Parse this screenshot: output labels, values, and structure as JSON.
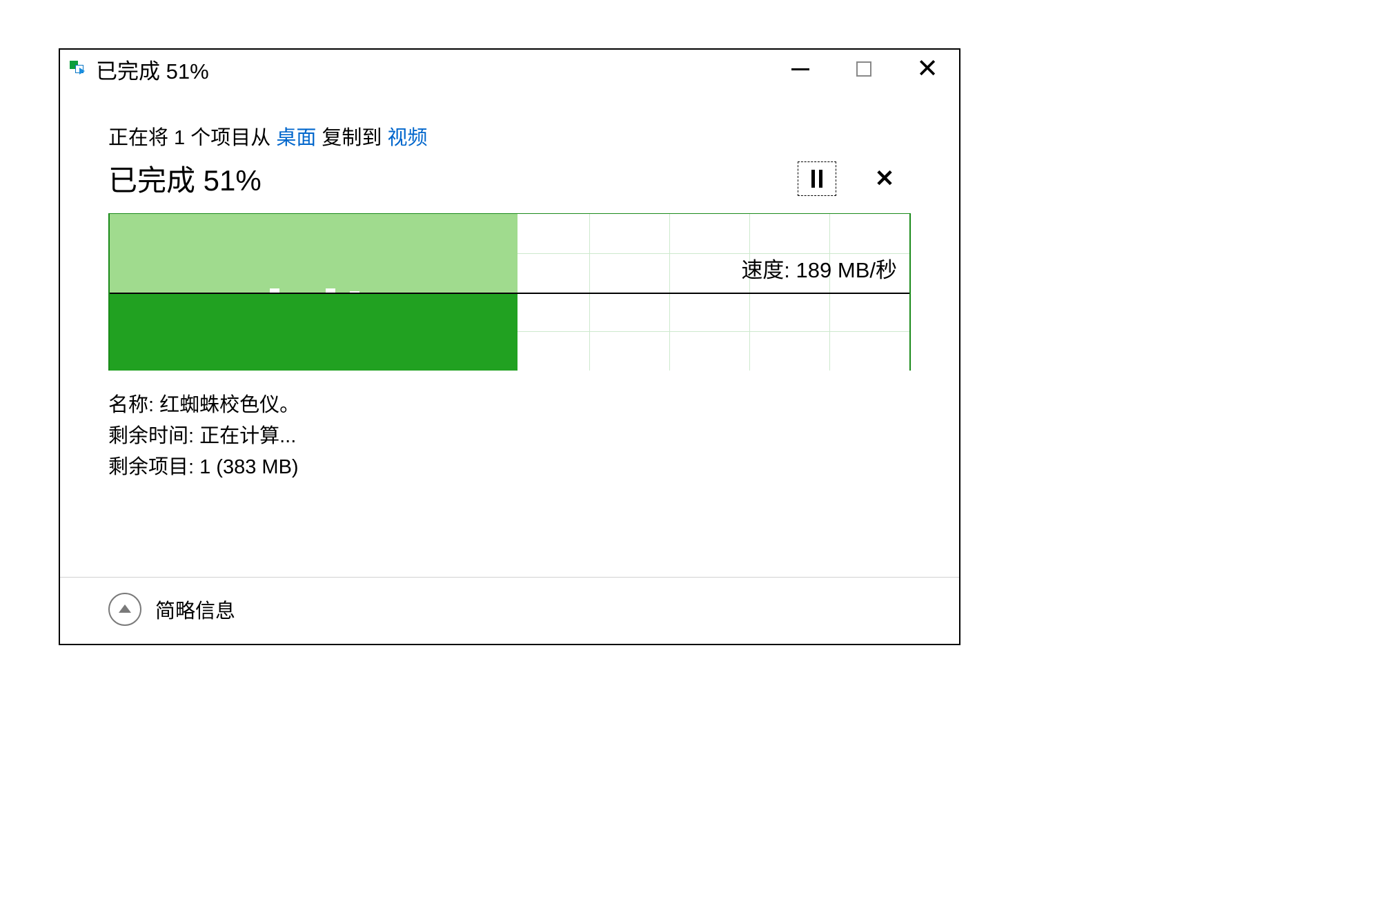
{
  "titlebar": {
    "title": "已完成 51%"
  },
  "copy_line": {
    "prefix": "正在将 1 个项目从 ",
    "source": "桌面",
    "middle": " 复制到 ",
    "destination": "视频"
  },
  "progress": {
    "percent_text": "已完成 51%",
    "fill_percent": 51,
    "speed_label_prefix": "速度: ",
    "speed_value": "189 MB/秒"
  },
  "details": {
    "name_label": "名称: ",
    "name_value": "红蜘蛛校色仪。",
    "time_label": "剩余时间: ",
    "time_value": "正在计算...",
    "items_label": "剩余项目: ",
    "items_value": "1 (383 MB)"
  },
  "footer": {
    "toggle_label": "简略信息"
  },
  "chart_data": {
    "type": "area",
    "title": "",
    "xlabel": "",
    "ylabel": "MB/秒",
    "ylim": [
      0,
      378
    ],
    "progress_percent": 51,
    "current_speed_mb_s": 189,
    "speed_history_mb_s": [
      189,
      189,
      189,
      186,
      185,
      187,
      188,
      189,
      189,
      189,
      190,
      189
    ]
  }
}
